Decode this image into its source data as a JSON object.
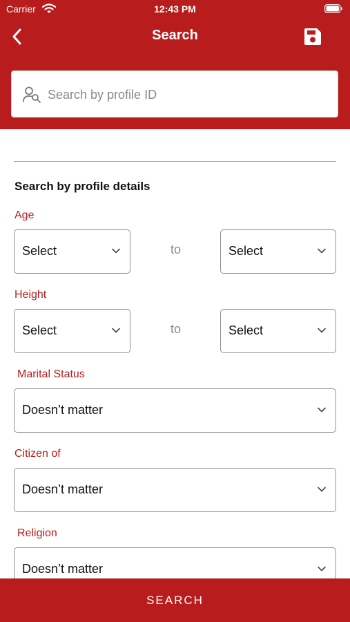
{
  "status_bar": {
    "carrier": "Carrier",
    "time": "12:43 PM"
  },
  "nav": {
    "title": "Search"
  },
  "search": {
    "placeholder": "Search by profile ID"
  },
  "section": {
    "title": "Search by profile details"
  },
  "fields": {
    "age": {
      "label": "Age",
      "from": "Select",
      "to_word": "to",
      "to": "Select"
    },
    "height": {
      "label": "Height",
      "from": "Select",
      "to_word": "to",
      "to": "Select"
    },
    "marital_status": {
      "label": "Marital Status",
      "value": "Doesn’t matter"
    },
    "citizen_of": {
      "label": "Citizen of",
      "value": "Doesn’t matter"
    },
    "religion": {
      "label": "Religion",
      "value": "Doesn’t matter"
    }
  },
  "bottom_button": {
    "label": "SEARCH"
  },
  "colors": {
    "accent": "#b91c1c",
    "border": "#8f8f8f",
    "placeholder": "#8a8a8a"
  }
}
